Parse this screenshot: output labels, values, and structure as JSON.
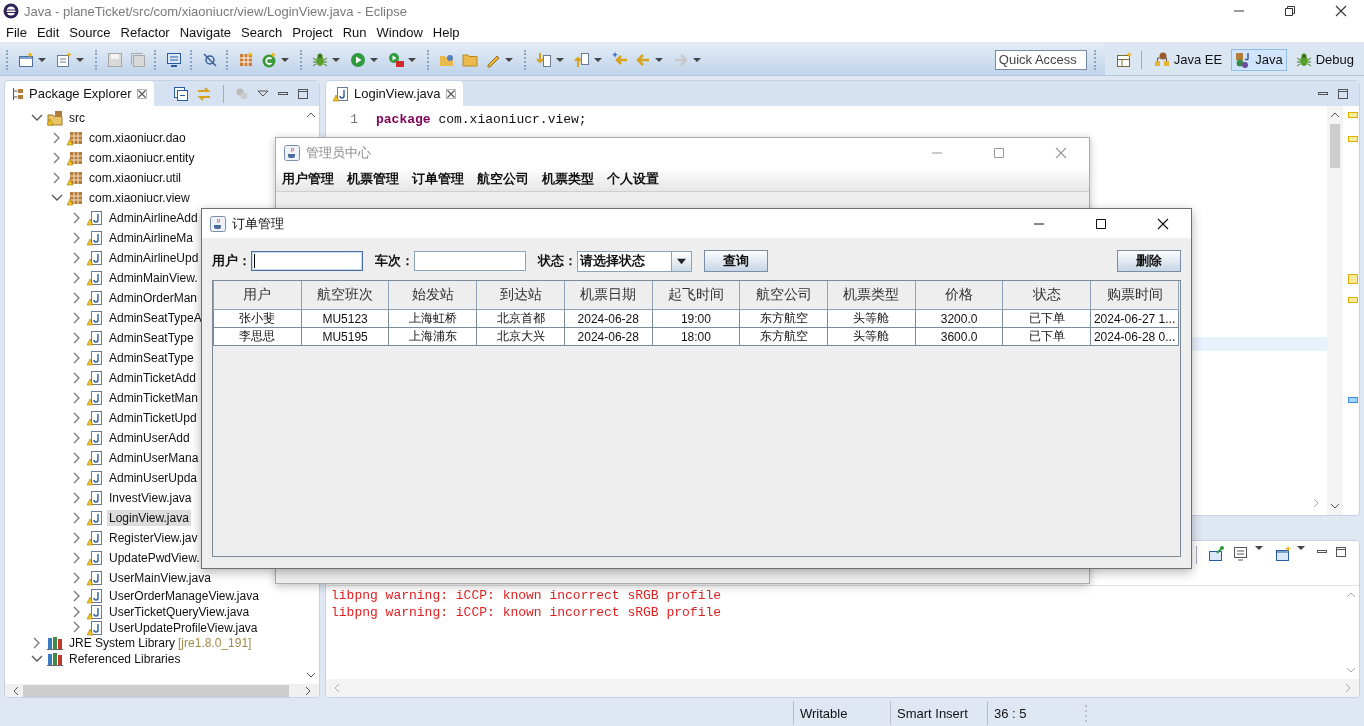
{
  "window": {
    "title": "Java - planeTicket/src/com/xiaoniucr/view/LoginView.java - Eclipse"
  },
  "menu_bar": [
    "File",
    "Edit",
    "Source",
    "Refactor",
    "Navigate",
    "Search",
    "Project",
    "Run",
    "Window",
    "Help"
  ],
  "toolbar": {
    "quick_access": {
      "placeholder": "Quick Access"
    },
    "perspectives": [
      {
        "label": "Java EE",
        "kind": "javaee",
        "selected": false
      },
      {
        "label": "Java",
        "kind": "java",
        "selected": true
      },
      {
        "label": "Debug",
        "kind": "debug",
        "selected": false
      }
    ]
  },
  "package_explorer": {
    "tab": {
      "label": "Package Explorer",
      "selected": true
    },
    "tree": [
      {
        "label": "src",
        "kind": "source-folder",
        "expanded": true,
        "selected": false,
        "children": [
          {
            "label": "com.xiaoniucr.dao",
            "kind": "package",
            "expanded": false,
            "selected": false
          },
          {
            "label": "com.xiaoniucr.entity",
            "kind": "package",
            "expanded": false,
            "selected": false
          },
          {
            "label": "com.xiaoniucr.util",
            "kind": "package",
            "expanded": false,
            "selected": false
          },
          {
            "label": "com.xiaoniucr.view",
            "kind": "package",
            "expanded": true,
            "selected": false,
            "children": [
              {
                "label": "AdminAirlineAdd",
                "kind": "java-file",
                "expanded": false,
                "selected": false
              },
              {
                "label": "AdminAirlineMa",
                "kind": "java-file",
                "expanded": false,
                "selected": false
              },
              {
                "label": "AdminAirlineUpd",
                "kind": "java-file",
                "expanded": false,
                "selected": false
              },
              {
                "label": "AdminMainView.",
                "kind": "java-file",
                "expanded": false,
                "selected": false
              },
              {
                "label": "AdminOrderMan",
                "kind": "java-file",
                "expanded": false,
                "selected": false
              },
              {
                "label": "AdminSeatTypeA",
                "kind": "java-file",
                "expanded": false,
                "selected": false
              },
              {
                "label": "AdminSeatType",
                "kind": "java-file",
                "expanded": false,
                "selected": false
              },
              {
                "label": "AdminSeatType",
                "kind": "java-file",
                "expanded": false,
                "selected": false
              },
              {
                "label": "AdminTicketAdd",
                "kind": "java-file",
                "expanded": false,
                "selected": false
              },
              {
                "label": "AdminTicketMan",
                "kind": "java-file",
                "expanded": false,
                "selected": false
              },
              {
                "label": "AdminTicketUpd",
                "kind": "java-file",
                "expanded": false,
                "selected": false
              },
              {
                "label": "AdminUserAdd",
                "kind": "java-file",
                "expanded": false,
                "selected": false
              },
              {
                "label": "AdminUserMana",
                "kind": "java-file",
                "expanded": false,
                "selected": false
              },
              {
                "label": "AdminUserUpda",
                "kind": "java-file",
                "expanded": false,
                "selected": false
              },
              {
                "label": "InvestView.java",
                "kind": "java-file",
                "expanded": false,
                "selected": false
              },
              {
                "label": "LoginView.java",
                "kind": "java-file",
                "expanded": false,
                "selected": true
              },
              {
                "label": "RegisterView.jav",
                "kind": "java-file",
                "expanded": false,
                "selected": false
              },
              {
                "label": "UpdatePwdView.",
                "kind": "java-file",
                "expanded": false,
                "selected": false
              },
              {
                "label": "UserMainView.java",
                "kind": "java-file",
                "expanded": false,
                "selected": false
              },
              {
                "label": "UserOrderManageView.java",
                "kind": "java-file",
                "expanded": false,
                "selected": false
              },
              {
                "label": "UserTicketQueryView.java",
                "kind": "java-file",
                "expanded": false,
                "selected": false
              },
              {
                "label": "UserUpdateProfileView.java",
                "kind": "java-file",
                "expanded": false,
                "selected": false
              }
            ]
          }
        ]
      },
      {
        "label": "JRE System Library",
        "suffix": "[jre1.8.0_191]",
        "kind": "library",
        "expanded": false,
        "selected": false
      },
      {
        "label": "Referenced Libraries",
        "kind": "library",
        "expanded": true,
        "selected": false
      }
    ]
  },
  "editor": {
    "tab": {
      "label": "LoginView.java",
      "selected": true
    },
    "lines": [
      {
        "number": "1",
        "tokens": [
          {
            "text": "package",
            "kind": "keyword"
          },
          {
            "text": " com.xiaoniucr.view;",
            "kind": "plain"
          }
        ]
      }
    ]
  },
  "console": {
    "lines": [
      "libpng warning: iCCP: known incorrect sRGB profile",
      "libpng warning: iCCP: known incorrect sRGB profile"
    ]
  },
  "status_bar": {
    "fields": [
      "Writable",
      "Smart Insert",
      "36 : 5"
    ]
  },
  "admin_window": {
    "title": "管理员中心",
    "active": false,
    "menu": [
      "用户管理",
      "机票管理",
      "订单管理",
      "航空公司",
      "机票类型",
      "个人设置"
    ]
  },
  "order_dialog": {
    "title": "订单管理",
    "active": true,
    "filters": [
      {
        "kind": "text",
        "label": "用户：",
        "focused": true
      },
      {
        "kind": "text",
        "label": "车次：",
        "focused": false
      },
      {
        "kind": "combo",
        "label": "状态：",
        "value": "请选择状态"
      }
    ],
    "search_button": "查询",
    "delete_button": "删除",
    "table": {
      "columns": [
        "用户",
        "航空班次",
        "始发站",
        "到达站",
        "机票日期",
        "起飞时间",
        "航空公司",
        "机票类型",
        "价格",
        "状态",
        "购票时间"
      ],
      "rows": [
        [
          "张小斐",
          "MU5123",
          "上海虹桥",
          "北京首都",
          "2024-06-28",
          "19:00",
          "东方航空",
          "头等舱",
          "3200.0",
          "已下单",
          "2024-06-27 1..."
        ],
        [
          "李思思",
          "MU5195",
          "上海浦东",
          "北京大兴",
          "2024-06-28",
          "18:00",
          "东方航空",
          "头等舱",
          "3600.0",
          "已下单",
          "2024-06-28 0..."
        ]
      ]
    }
  }
}
